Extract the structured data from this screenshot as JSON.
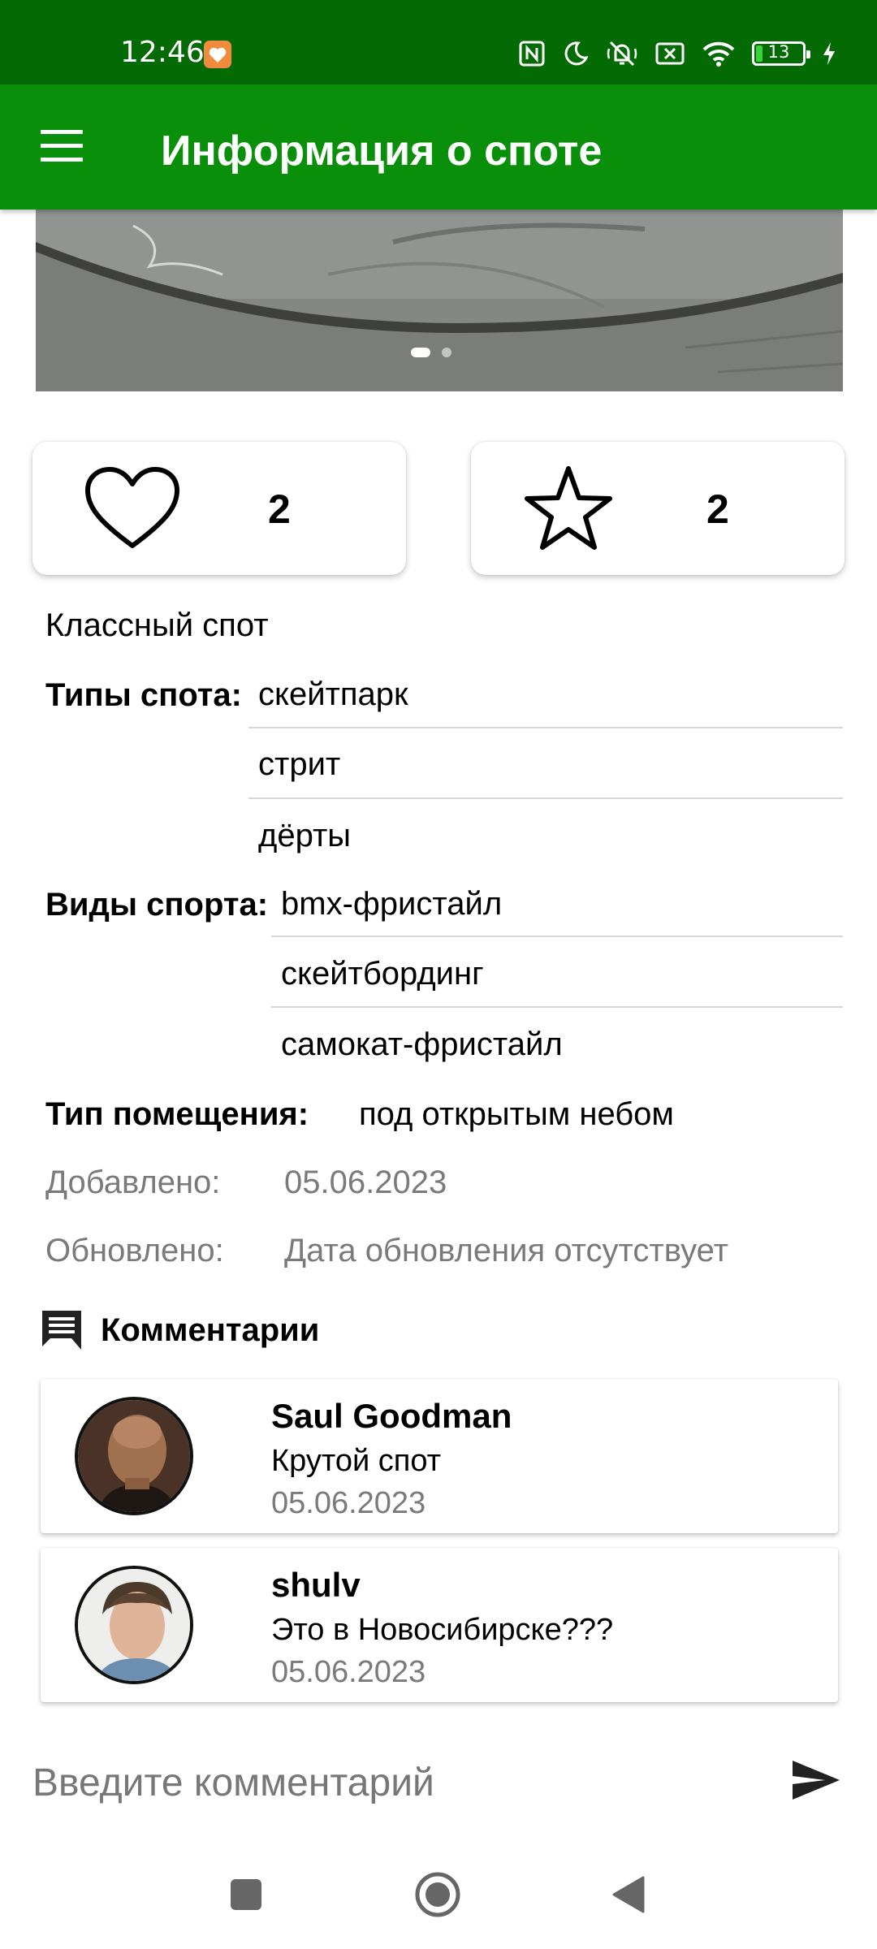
{
  "status_bar": {
    "time": "12:46",
    "icons": [
      "nfc-icon",
      "moon-icon",
      "vibrate-off-icon",
      "sim-off-icon",
      "wifi-icon",
      "battery-icon",
      "charging-icon"
    ],
    "battery": "13"
  },
  "toolbar": {
    "menu_icon": "menu-icon",
    "title": "Информация о споте"
  },
  "gallery": {
    "page_count": 2,
    "current_page": 1
  },
  "counters": {
    "likes": "2",
    "favorites": "2"
  },
  "spot": {
    "description": "Классный спот",
    "types_label": "Типы спота:",
    "types": [
      "скейтпарк",
      "стрит",
      "дёрты"
    ],
    "sports_label": "Виды спорта:",
    "sports": [
      "bmx-фристайл",
      "скейтбординг",
      "самокат-фристайл"
    ],
    "space_label": "Тип помещения:",
    "space_value": "под открытым небом",
    "added_label": "Добавлено:",
    "added_value": "05.06.2023",
    "updated_label": "Обновлено:",
    "updated_value": "Дата обновления отсутствует"
  },
  "comments": {
    "title": "Комментарии",
    "items": [
      {
        "name": "Saul Goodman",
        "text": "Крутой спот",
        "date": "05.06.2023"
      },
      {
        "name": "shulv",
        "text": "Это в Новосибирске???",
        "date": "05.06.2023"
      }
    ]
  },
  "comment_input": {
    "placeholder": "Введите комментарий",
    "value": ""
  },
  "colors": {
    "status_bar": "#046a04",
    "toolbar": "#0a8f0a",
    "secondary_text": "#7a7a7a"
  }
}
